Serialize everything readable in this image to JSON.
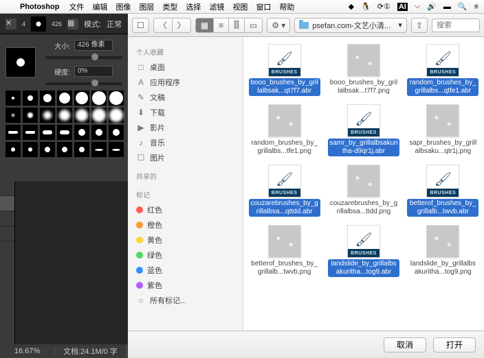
{
  "menubar": {
    "app": "Photoshop",
    "items": [
      "文件",
      "编辑",
      "图像",
      "图层",
      "类型",
      "选择",
      "滤镜",
      "视图",
      "窗口",
      "帮助"
    ],
    "right_icons": [
      "cc-icon",
      "penguin-icon",
      "updates-icon",
      "ai-icon",
      "wifi-icon",
      "volume-icon",
      "battery-icon",
      "search-icon",
      "menu-icon"
    ]
  },
  "ps_options": {
    "mode_label": "模式:",
    "mode_value": "正常",
    "brush_num_1": "4",
    "brush_num_2": "426"
  },
  "brush_panel": {
    "size_label": "大小:",
    "size_value": "426 像素",
    "hardness_label": "硬度:",
    "hardness_value": "0%"
  },
  "statusbar": {
    "zoom": "16.67%",
    "doc": "文档:24.1M/0 字"
  },
  "finder": {
    "path": "psefan.com-文艺小清...",
    "search_placeholder": "搜索",
    "sidebar": {
      "sections": {
        "fav": "个人收藏",
        "shared": "共享的",
        "tags": "标记"
      },
      "fav_items": [
        {
          "icon": "□",
          "label": "桌面"
        },
        {
          "icon": "A",
          "label": "应用程序"
        },
        {
          "icon": "✎",
          "label": "文稿"
        },
        {
          "icon": "⬇",
          "label": "下载"
        },
        {
          "icon": "▶",
          "label": "影片"
        },
        {
          "icon": "♪",
          "label": "音乐"
        },
        {
          "icon": "☐",
          "label": "图片"
        }
      ],
      "tags": [
        {
          "color": "#ff5a4f",
          "label": "红色"
        },
        {
          "color": "#ff9a2e",
          "label": "橙色"
        },
        {
          "color": "#ffd23a",
          "label": "黄色"
        },
        {
          "color": "#4cd964",
          "label": "绿色"
        },
        {
          "color": "#2f8fff",
          "label": "蓝色"
        },
        {
          "color": "#b45eff",
          "label": "紫色"
        }
      ],
      "all_tags": "所有标记..."
    },
    "files": [
      {
        "type": "abr",
        "name": "booo_brushes_by_grillalbsak...qt7f7.abr",
        "sel": true
      },
      {
        "type": "png",
        "name": "booo_brushes_by_grillalbsak...t7f7.png",
        "sel": false
      },
      {
        "type": "abr",
        "name": "random_brushes_by_grillalbs...qtfe1.abr",
        "sel": true
      },
      {
        "type": "png",
        "name": "random_brushes_by_grillalbs...tfe1.png",
        "sel": false
      },
      {
        "type": "abr",
        "name": "samr_by_grillalbsakuritha-d9qr1j.abr",
        "sel": true
      },
      {
        "type": "png",
        "name": "sapr_brushes_by_grillalbsaku...qtr1j.png",
        "sel": false
      },
      {
        "type": "abr",
        "name": "couzarebrushes_by_grillalbsa...qttdd.abr",
        "sel": true
      },
      {
        "type": "png",
        "name": "couzarebrushes_by_grillalbsa...ttdd.png",
        "sel": false
      },
      {
        "type": "abr",
        "name": "betterof_brushes_by_grillalb...twvb.abr",
        "sel": true
      },
      {
        "type": "png",
        "name": "betterof_brushes_by_grillalb...twvb.png",
        "sel": false
      },
      {
        "type": "abr",
        "name": "landslide_by_grillalbsakuritha...tog9.abr",
        "sel": true
      },
      {
        "type": "png",
        "name": "landslide_by_grillalbsakuritha...tog9.png",
        "sel": false
      }
    ],
    "btag_label": "BRUSHES",
    "buttons": {
      "cancel": "取消",
      "open": "打开"
    }
  }
}
